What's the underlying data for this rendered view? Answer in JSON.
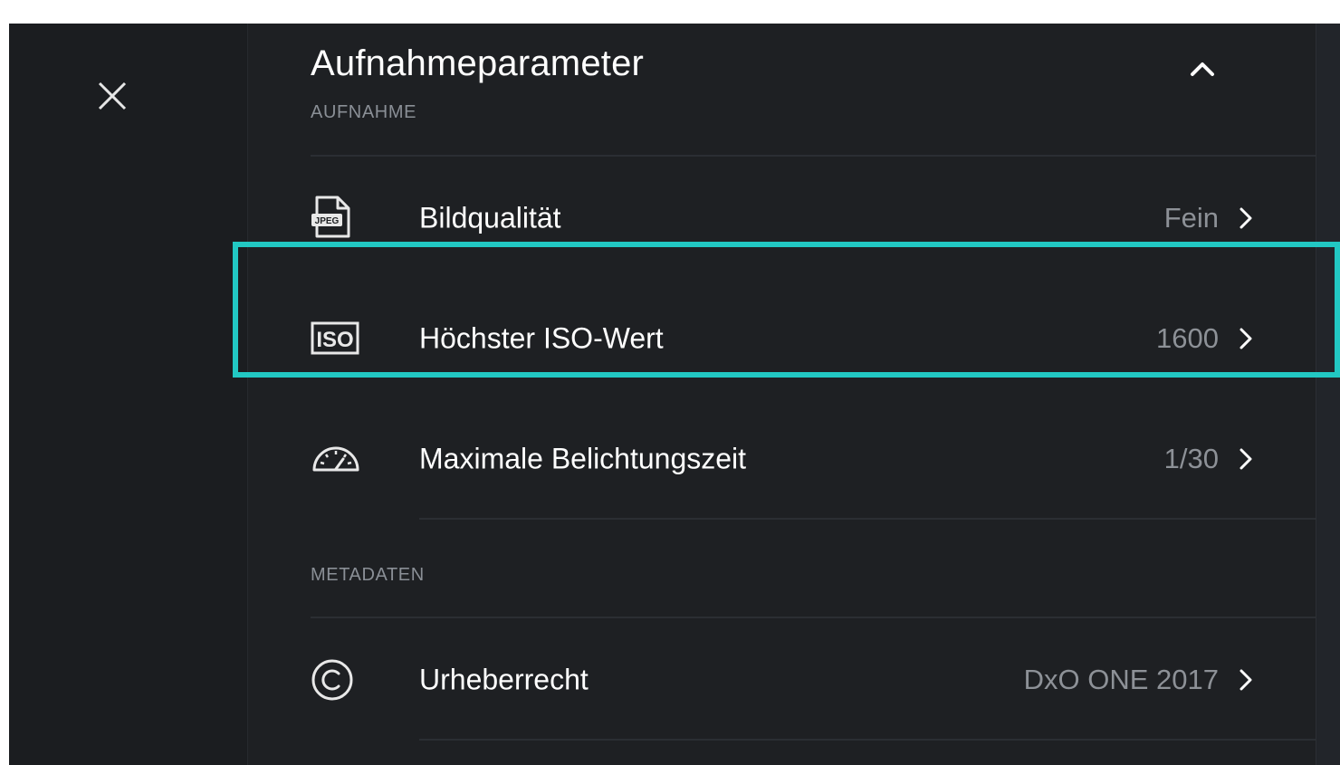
{
  "header": {
    "title": "Aufnahmeparameter"
  },
  "sections": [
    {
      "label": "AUFNAHME",
      "items": [
        {
          "icon": "jpeg-file-icon",
          "label": "Bildqualität",
          "value": "Fein"
        },
        {
          "icon": "iso-icon",
          "label": "Höchster ISO-Wert",
          "value": "1600"
        },
        {
          "icon": "speedometer-icon",
          "label": "Maximale Belichtungszeit",
          "value": "1/30"
        }
      ]
    },
    {
      "label": "METADATEN",
      "items": [
        {
          "icon": "copyright-icon",
          "label": "Urheberrecht",
          "value": "DxO ONE 2017"
        }
      ]
    }
  ],
  "icons": {
    "jpeg_text": "JPEG",
    "iso_text": "ISO"
  },
  "colors": {
    "background": "#1e2023",
    "sidebar": "#1b1d20",
    "focus": "#22c8c3",
    "text": "#ffffff",
    "muted": "#8d9197"
  }
}
